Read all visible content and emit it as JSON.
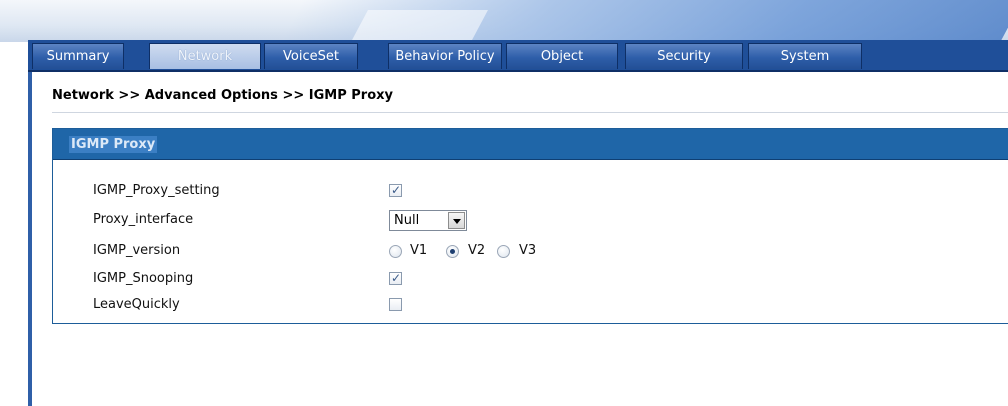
{
  "tabs": [
    {
      "label": "Summary",
      "active": false
    },
    {
      "label": "Network",
      "active": true
    },
    {
      "label": "VoiceSet",
      "active": false
    },
    {
      "label": "Behavior Policy",
      "active": false
    },
    {
      "label": "Object",
      "active": false
    },
    {
      "label": "Security",
      "active": false
    },
    {
      "label": "System",
      "active": false
    }
  ],
  "breadcrumb": "Network >> Advanced Options >> IGMP Proxy",
  "panel": {
    "title": "IGMP Proxy",
    "fields": {
      "igmp_proxy_setting": {
        "label": "IGMP_Proxy_setting",
        "checked": true
      },
      "proxy_interface": {
        "label": "Proxy_interface",
        "value": "Null"
      },
      "igmp_version": {
        "label": "IGMP_version",
        "options": [
          "V1",
          "V2",
          "V3"
        ],
        "selected": "V2"
      },
      "igmp_snooping": {
        "label": "IGMP_Snooping",
        "checked": true
      },
      "leave_quickly": {
        "label": "LeaveQuickly",
        "checked": false
      }
    }
  },
  "icons": {
    "check": "✓",
    "dropdown": "chevron-down-icon"
  },
  "colors": {
    "tabbar": "#1f4f99",
    "panel_header": "#1f66a8",
    "panel_border": "#1d5d99",
    "active_tab": "#a8bfe3"
  }
}
